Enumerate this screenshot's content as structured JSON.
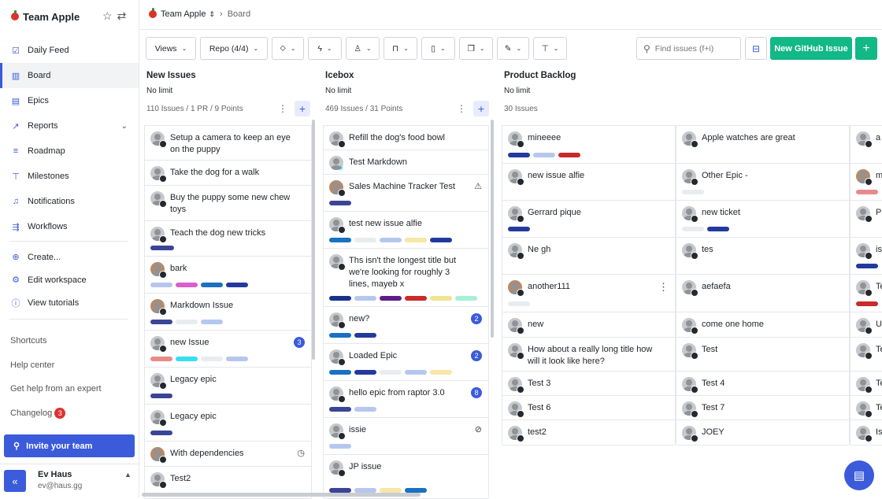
{
  "workspace": {
    "name": "Team Apple"
  },
  "nav": [
    {
      "label": "Daily Feed",
      "icon": "checkbox-icon"
    },
    {
      "label": "Board",
      "icon": "board-icon",
      "active": true
    },
    {
      "label": "Epics",
      "icon": "epic-icon"
    },
    {
      "label": "Reports",
      "icon": "chart-icon"
    },
    {
      "label": "Roadmap",
      "icon": "roadmap-icon"
    },
    {
      "label": "Milestones",
      "icon": "milestone-icon"
    },
    {
      "label": "Notifications",
      "icon": "bell-icon"
    },
    {
      "label": "Workflows",
      "icon": "workflow-icon"
    }
  ],
  "nav2": [
    {
      "label": "Create...",
      "icon": "plus-circle-icon"
    },
    {
      "label": "Edit workspace",
      "icon": "gear-icon"
    },
    {
      "label": "View tutorials",
      "icon": "info-icon"
    }
  ],
  "links": {
    "shortcuts": "Shortcuts",
    "help": "Help center",
    "expert": "Get help from an expert",
    "changelog": "Changelog",
    "changelog_count": "3"
  },
  "invite": "Invite your team",
  "user": {
    "name": "Ev Haus",
    "email": "ev@haus.gg"
  },
  "breadcrumb": {
    "workspace": "Team Apple",
    "page": "Board"
  },
  "toolbar": {
    "views": "Views",
    "repo": "Repo (4/4)",
    "search_placeholder": "Find issues (f+i)",
    "new_issue": "New GitHub Issue"
  },
  "colors": {
    "accent": "#3b5bdb",
    "green": "#12b886"
  },
  "columns": [
    {
      "title": "New Issues",
      "limit": "No limit",
      "meta": "110 Issues / 1 PR / 9 Points",
      "cards": [
        {
          "title": "Setup a camera to keep an eye on the puppy"
        },
        {
          "title": "Take the dog for a walk"
        },
        {
          "title": "Buy the puppy some new chew toys"
        },
        {
          "title": "Teach the dog new tricks"
        },
        {
          "title": "bark"
        },
        {
          "title": "Markdown Issue"
        },
        {
          "title": "new Issue",
          "count": "3"
        },
        {
          "title": "Legacy epic"
        },
        {
          "title": "Legacy epic"
        },
        {
          "title": "With dependencies"
        },
        {
          "title": "Test2"
        }
      ]
    },
    {
      "title": "Icebox",
      "limit": "No limit",
      "meta": "469 Issues / 31 Points",
      "cards": [
        {
          "title": "Refill the dog's food bowl"
        },
        {
          "title": "Test Markdown"
        },
        {
          "title": "Sales Machine Tracker Test"
        },
        {
          "title": "test new issue alfie"
        },
        {
          "title": "Ths isn't the longest title but we're looking for roughly 3 lines, mayeb x"
        },
        {
          "title": "new?",
          "count": "2"
        },
        {
          "title": "Loaded Epic",
          "count": "2"
        },
        {
          "title": "hello epic from raptor 3.0",
          "count": "8"
        },
        {
          "title": "issie"
        },
        {
          "title": "JP issue"
        }
      ]
    },
    {
      "title": "Product Backlog",
      "limit": "No limit",
      "meta": "30 Issues",
      "cards": [
        {
          "title": "mineeee"
        },
        {
          "title": "new issue alfie"
        },
        {
          "title": "Gerrard pique"
        },
        {
          "title": "Ne gh"
        },
        {
          "title": "another111"
        },
        {
          "title": "new"
        },
        {
          "title": "How about a really long title how will it look like here?"
        },
        {
          "title": "Test 3"
        },
        {
          "title": "Test 6"
        },
        {
          "title": "test2"
        }
      ]
    },
    {
      "title": "",
      "limit": "",
      "meta": "",
      "cards": [
        {
          "title": "Apple watches are great"
        },
        {
          "title": "Other Epic -"
        },
        {
          "title": "new ticket"
        },
        {
          "title": "tes"
        },
        {
          "title": "aefaefa"
        },
        {
          "title": "come one home"
        },
        {
          "title": "Test"
        },
        {
          "title": "Test 4"
        },
        {
          "title": "Test 7"
        },
        {
          "title": "JOEY"
        }
      ]
    },
    {
      "title": "",
      "limit": "",
      "meta": "",
      "cards": [
        {
          "title": "a"
        },
        {
          "title": "m"
        },
        {
          "title": "Pr"
        },
        {
          "title": "is"
        },
        {
          "title": "Te"
        },
        {
          "title": "Ul"
        },
        {
          "title": "Te"
        },
        {
          "title": "Te"
        },
        {
          "title": "Te"
        },
        {
          "title": "Is"
        }
      ]
    }
  ]
}
